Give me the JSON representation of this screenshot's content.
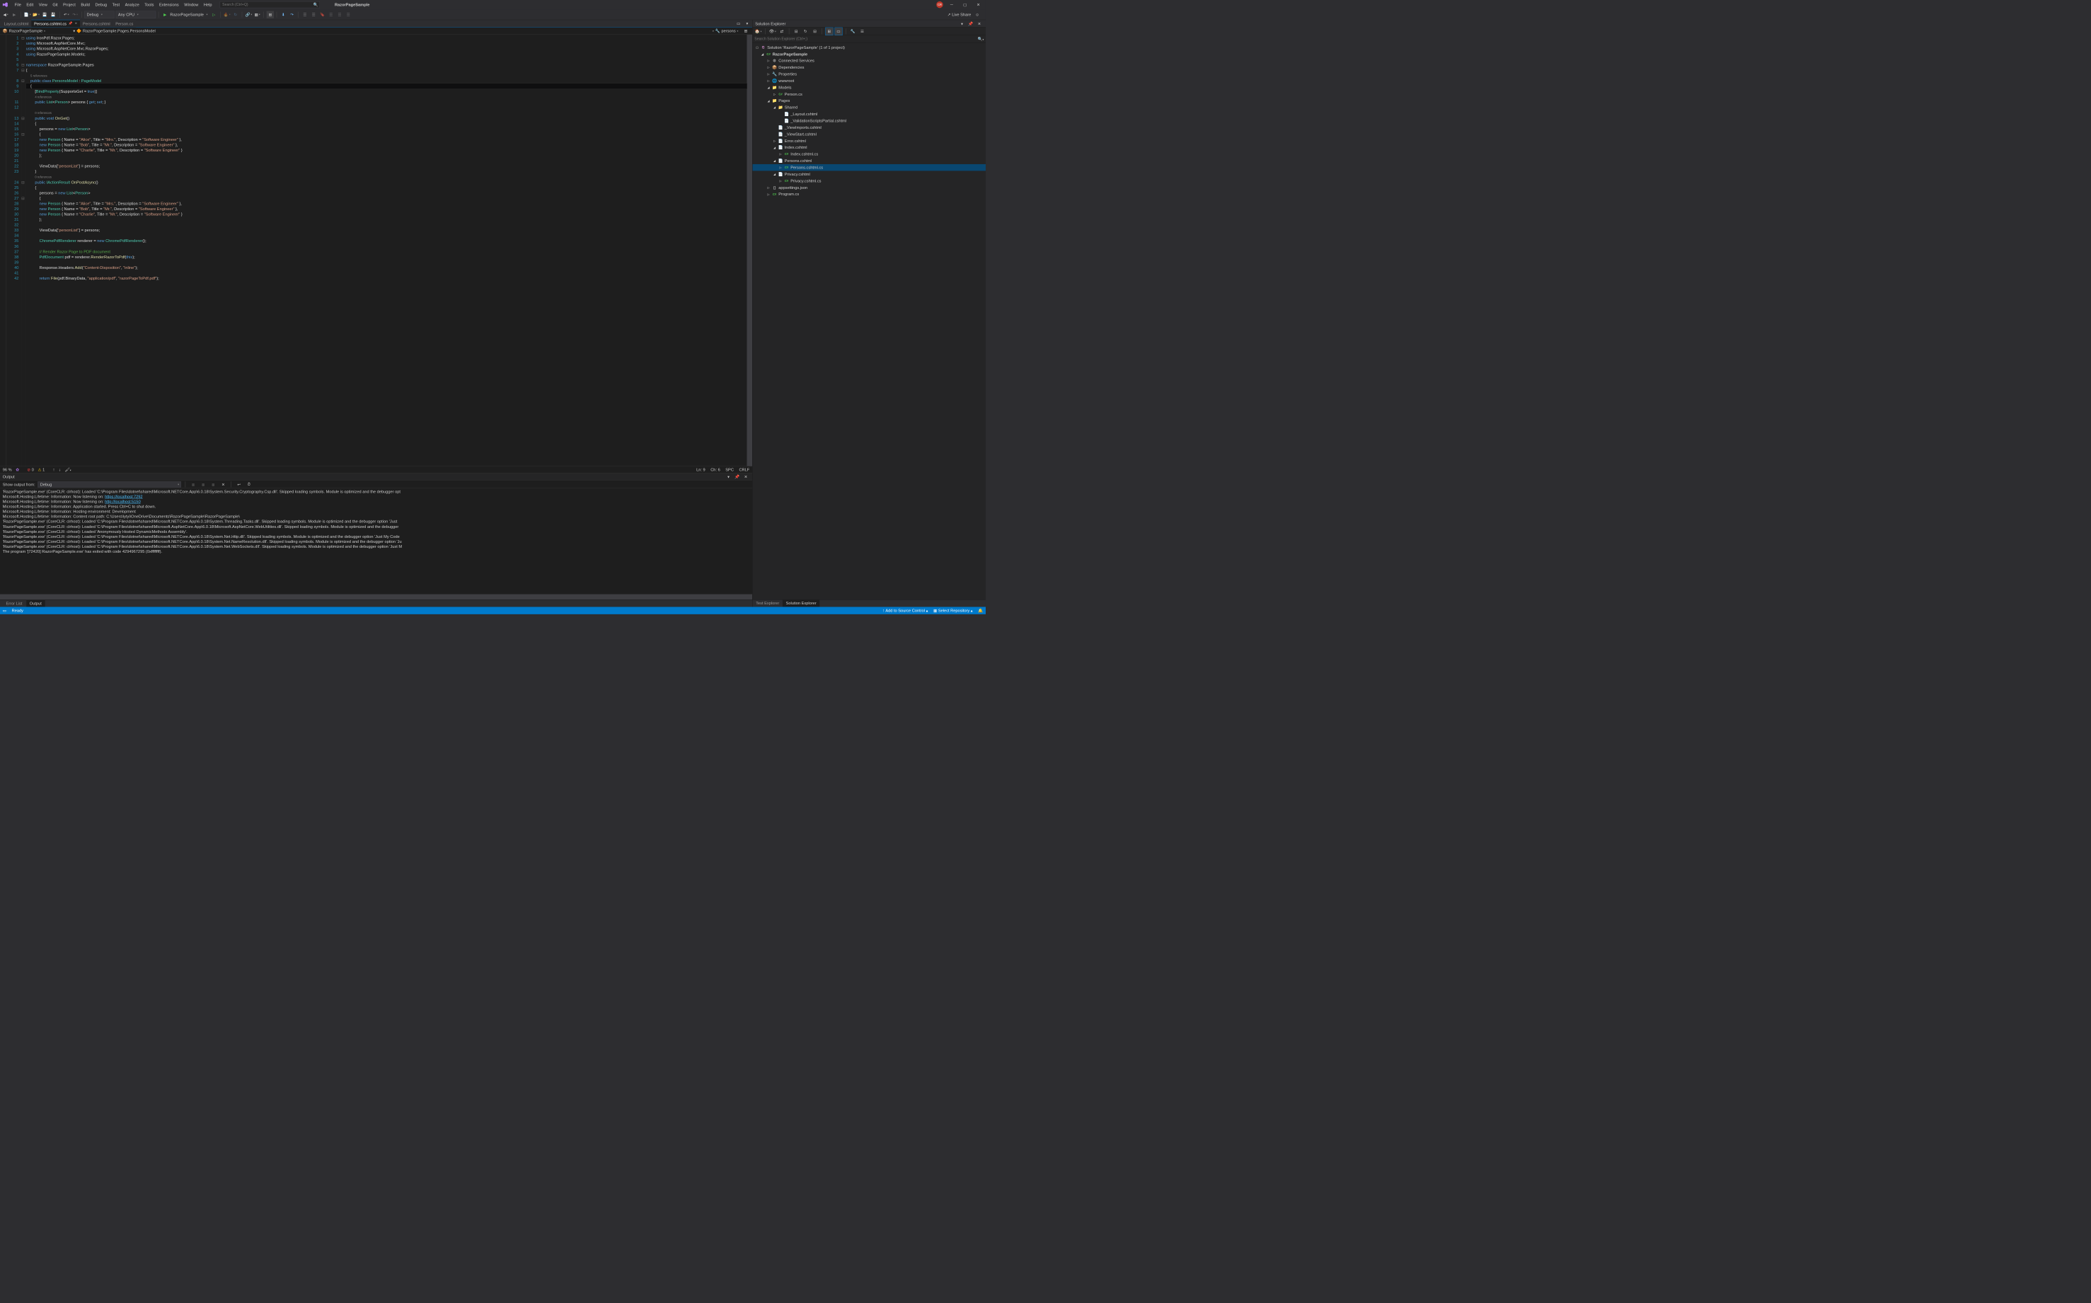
{
  "title": "RazorPageSample",
  "menu": [
    "File",
    "Edit",
    "View",
    "Git",
    "Project",
    "Build",
    "Debug",
    "Test",
    "Analyze",
    "Tools",
    "Extensions",
    "Window",
    "Help"
  ],
  "search_placeholder": "Search (Ctrl+Q)",
  "avatar_initials": "CR",
  "toolbar": {
    "config": "Debug",
    "platform": "Any CPU",
    "run_target": "RazorPageSample",
    "live_share": "Live Share"
  },
  "tabs": [
    {
      "label": "Layout.cshtml",
      "active": false
    },
    {
      "label": "Persons.cshtml.cs",
      "active": true
    },
    {
      "label": "Persons.cshtml",
      "active": false
    },
    {
      "label": "Person.cs",
      "active": false
    }
  ],
  "breadcrumb": {
    "project": "RazorPageSample",
    "namespace": "RazorPageSample.Pages.PersonsModel",
    "member": "persons"
  },
  "code_lines": [
    {
      "n": 1,
      "html": "<span class='kw'>using</span> IronPdf.Razor.Pages;"
    },
    {
      "n": 2,
      "html": "<span class='kw'>using</span> Microsoft.AspNetCore.Mvc;"
    },
    {
      "n": 3,
      "html": "<span class='kw'>using</span> Microsoft.AspNetCore.Mvc.RazorPages;"
    },
    {
      "n": 4,
      "html": "<span class='kw'>using</span> RazorPageSample.Models;"
    },
    {
      "n": 5,
      "html": ""
    },
    {
      "n": 6,
      "html": "<span class='kw'>namespace</span> RazorPageSample.Pages"
    },
    {
      "n": 7,
      "html": "{"
    },
    {
      "n": 0,
      "html": "    <span class='ref'>5 references</span>"
    },
    {
      "n": 8,
      "html": "    <span class='kw'>public</span> <span class='kw'>class</span> <span class='typ'>PersonsModel</span> : <span class='typ'>PageModel</span>"
    },
    {
      "n": 9,
      "html": "    {",
      "cl": true
    },
    {
      "n": 10,
      "html": "        [<span class='typ'>BindProperty</span>(SupportsGet = <span class='kw'>true</span>)]"
    },
    {
      "n": 0,
      "html": "        <span class='ref'>4 references</span>"
    },
    {
      "n": 11,
      "html": "        <span class='kw'>public</span> <span class='typ'>List</span>&lt;<span class='typ'>Person</span>&gt; persons { <span class='kw'>get</span>; <span class='kw'>set</span>; }"
    },
    {
      "n": 12,
      "html": ""
    },
    {
      "n": 0,
      "html": "        <span class='ref'>0 references</span>"
    },
    {
      "n": 13,
      "html": "        <span class='kw'>public</span> <span class='kw'>void</span> <span class='fn'>OnGet</span>()"
    },
    {
      "n": 14,
      "html": "        {"
    },
    {
      "n": 15,
      "html": "            persons = <span class='kw'>new</span> <span class='typ'>List</span>&lt;<span class='typ'>Person</span>&gt;"
    },
    {
      "n": 16,
      "html": "            {"
    },
    {
      "n": 17,
      "html": "            <span class='kw'>new</span> <span class='typ'>Person</span> { Name = <span class='str'>\"Alice\"</span>, Title = <span class='str'>\"Mrs.\"</span>, Description = <span class='str'>\"Software Engineer\"</span> },"
    },
    {
      "n": 18,
      "html": "            <span class='kw'>new</span> <span class='typ'>Person</span> { Name = <span class='str'>\"Bob\"</span>, Title = <span class='str'>\"Mr.\"</span>, Description = <span class='str'>\"Software Engineer\"</span> },"
    },
    {
      "n": 19,
      "html": "            <span class='kw'>new</span> <span class='typ'>Person</span> { Name = <span class='str'>\"Charlie\"</span>, Title = <span class='str'>\"Mr.\"</span>, Description = <span class='str'>\"Software Engineer\"</span> }"
    },
    {
      "n": 20,
      "html": "            };"
    },
    {
      "n": 21,
      "html": ""
    },
    {
      "n": 22,
      "html": "            ViewData[<span class='str'>\"personList\"</span>] = persons;"
    },
    {
      "n": 23,
      "html": "        }"
    },
    {
      "n": 0,
      "html": "        <span class='ref'>0 references</span>"
    },
    {
      "n": 24,
      "html": "        <span class='kw'>public</span> <span class='typ'>IActionResult</span> <span class='fn'>OnPostAsync</span>()"
    },
    {
      "n": 25,
      "html": "        {"
    },
    {
      "n": 26,
      "html": "            persons = <span class='kw'>new</span> <span class='typ'>List</span>&lt;<span class='typ'>Person</span>&gt;"
    },
    {
      "n": 27,
      "html": "            {"
    },
    {
      "n": 28,
      "html": "            <span class='kw'>new</span> <span class='typ'>Person</span> { Name = <span class='str'>\"Alice\"</span>, Title = <span class='str'>\"Mrs.\"</span>, Description = <span class='str'>\"Software Engineer\"</span> },"
    },
    {
      "n": 29,
      "html": "            <span class='kw'>new</span> <span class='typ'>Person</span> { Name = <span class='str'>\"Bob\"</span>, Title = <span class='str'>\"Mr.\"</span>, Description = <span class='str'>\"Software Engineer\"</span> },"
    },
    {
      "n": 30,
      "html": "            <span class='kw'>new</span> <span class='typ'>Person</span> { Name = <span class='str'>\"Charlie\"</span>, Title = <span class='str'>\"Mr.\"</span>, Description = <span class='str'>\"Software Engineer\"</span> }"
    },
    {
      "n": 31,
      "html": "            };"
    },
    {
      "n": 32,
      "html": ""
    },
    {
      "n": 33,
      "html": "            ViewData[<span class='str'>\"personList\"</span>] = persons;"
    },
    {
      "n": 34,
      "html": ""
    },
    {
      "n": 35,
      "html": "            <span class='typ'>ChromePdfRenderer</span> renderer = <span class='kw'>new</span> <span class='typ'>ChromePdfRenderer</span>();"
    },
    {
      "n": 36,
      "html": ""
    },
    {
      "n": 37,
      "html": "            <span class='com'>// Render Razor Page to PDF document</span>"
    },
    {
      "n": 38,
      "html": "            <span class='typ'>PdfDocument</span> pdf = renderer.<span class='fn'>RenderRazorToPdf</span>(<span class='kw'>this</span>);"
    },
    {
      "n": 39,
      "html": ""
    },
    {
      "n": 40,
      "html": "            Response.Headers.<span class='fn'>Add</span>(<span class='str'>\"Content-Disposition\"</span>, <span class='str'>\"inline\"</span>);"
    },
    {
      "n": 41,
      "html": ""
    },
    {
      "n": 42,
      "html": "            <span class='kw'>return</span> <span class='fn'>File</span>(pdf.BinaryData, <span class='str'>\"application/pdf\"</span>, <span class='str'>\"razorPageToPdf.pdf\"</span>);"
    }
  ],
  "editor_status": {
    "zoom": "96 %",
    "errors": "0",
    "warnings": "1",
    "ln": "Ln: 9",
    "ch": "Ch: 6",
    "spc": "SPC",
    "crlf": "CRLF"
  },
  "output": {
    "title": "Output",
    "from_label": "Show output from:",
    "from_value": "Debug",
    "lines": [
      "'RazorPageSample.exe' (CoreCLR: clrhost): Loaded 'C:\\Program Files\\dotnet\\shared\\Microsoft.NETCore.App\\6.0.18\\System.Security.Cryptography.Csp.dll'. Skipped loading symbols. Module is optimized and the debugger opt",
      "Microsoft.Hosting.Lifetime: Information: Now listening on: <span class='link'>https://localhost:7292</span>",
      "Microsoft.Hosting.Lifetime: Information: Now listening on: <span class='link'>http://localhost:5150</span>",
      "Microsoft.Hosting.Lifetime: Information: Application started. Press Ctrl+C to shut down.",
      "Microsoft.Hosting.Lifetime: Information: Hosting environment: Development",
      "Microsoft.Hosting.Lifetime: Information: Content root path: C:\\Users\\lytyi\\OneDrive\\Documents\\RazorPageSample\\RazorPageSample\\",
      "'RazorPageSample.exe' (CoreCLR: clrhost): Loaded 'C:\\Program Files\\dotnet\\shared\\Microsoft.NETCore.App\\6.0.18\\System.Threading.Tasks.dll'. Skipped loading symbols. Module is optimized and the debugger option 'Just",
      "'RazorPageSample.exe' (CoreCLR: clrhost): Loaded 'C:\\Program Files\\dotnet\\shared\\Microsoft.AspNetCore.App\\6.0.18\\Microsoft.AspNetCore.WebUtilities.dll'. Skipped loading symbols. Module is optimized and the debugger",
      "'RazorPageSample.exe' (CoreCLR: clrhost): Loaded 'Anonymously Hosted DynamicMethods Assembly'.",
      "'RazorPageSample.exe' (CoreCLR: clrhost): Loaded 'C:\\Program Files\\dotnet\\shared\\Microsoft.NETCore.App\\6.0.18\\System.Net.Http.dll'. Skipped loading symbols. Module is optimized and the debugger option 'Just My Code",
      "'RazorPageSample.exe' (CoreCLR: clrhost): Loaded 'C:\\Program Files\\dotnet\\shared\\Microsoft.NETCore.App\\6.0.18\\System.Net.NameResolution.dll'. Skipped loading symbols. Module is optimized and the debugger option 'Ju",
      "'RazorPageSample.exe' (CoreCLR: clrhost): Loaded 'C:\\Program Files\\dotnet\\shared\\Microsoft.NETCore.App\\6.0.18\\System.Net.WebSockets.dll'. Skipped loading symbols. Module is optimized and the debugger option 'Just M",
      "The program '[72420] RazorPageSample.exe' has exited with code 4294967295 (0xffffffff).",
      ""
    ]
  },
  "bottom_tabs": [
    {
      "label": "Error List",
      "active": false
    },
    {
      "label": "Output",
      "active": true
    }
  ],
  "solution": {
    "title": "Solution Explorer",
    "search_placeholder": "Search Solution Explorer (Ctrl+;)",
    "root": "Solution 'RazorPageSample' (1 of 1 project)",
    "tree": [
      {
        "ind": 1,
        "exp": "▢",
        "icon": "cs",
        "label": "RazorPageSample",
        "bold": true
      },
      {
        "ind": 2,
        "exp": "▷",
        "icon": "⚙",
        "label": "Connected Services"
      },
      {
        "ind": 2,
        "exp": "▷",
        "icon": "📦",
        "label": "Dependencies"
      },
      {
        "ind": 2,
        "exp": "▷",
        "icon": "🔧",
        "label": "Properties"
      },
      {
        "ind": 2,
        "exp": "▷",
        "icon": "🌐",
        "label": "wwwroot"
      },
      {
        "ind": 2,
        "exp": "▢",
        "icon": "📁",
        "label": "Models"
      },
      {
        "ind": 3,
        "exp": "▷",
        "icon": "C#",
        "label": "Person.cs"
      },
      {
        "ind": 2,
        "exp": "▢",
        "icon": "📁",
        "label": "Pages"
      },
      {
        "ind": 3,
        "exp": "▢",
        "icon": "📁",
        "label": "Shared"
      },
      {
        "ind": 4,
        "exp": "",
        "icon": "📄",
        "label": "_Layout.cshtml"
      },
      {
        "ind": 4,
        "exp": "",
        "icon": "📄",
        "label": "_ValidationScriptsPartial.cshtml"
      },
      {
        "ind": 3,
        "exp": "",
        "icon": "📄",
        "label": "_ViewImports.cshtml"
      },
      {
        "ind": 3,
        "exp": "",
        "icon": "📄",
        "label": "_ViewStart.cshtml"
      },
      {
        "ind": 3,
        "exp": "▷",
        "icon": "📄",
        "label": "Error.cshtml"
      },
      {
        "ind": 3,
        "exp": "▢",
        "icon": "📄",
        "label": "Index.cshtml"
      },
      {
        "ind": 4,
        "exp": "▷",
        "icon": "C#",
        "label": "Index.cshtml.cs"
      },
      {
        "ind": 3,
        "exp": "▢",
        "icon": "📄",
        "label": "Persons.cshtml"
      },
      {
        "ind": 4,
        "exp": "▷",
        "icon": "C#",
        "label": "Persons.cshtml.cs",
        "selected": true
      },
      {
        "ind": 3,
        "exp": "▢",
        "icon": "📄",
        "label": "Privacy.cshtml"
      },
      {
        "ind": 4,
        "exp": "▷",
        "icon": "C#",
        "label": "Privacy.cshtml.cs"
      },
      {
        "ind": 2,
        "exp": "▷",
        "icon": "{}",
        "label": "appsettings.json"
      },
      {
        "ind": 2,
        "exp": "▷",
        "icon": "C#",
        "label": "Program.cs"
      }
    ],
    "bottom_tabs": [
      {
        "label": "Test Explorer",
        "active": false
      },
      {
        "label": "Solution Explorer",
        "active": true
      }
    ]
  },
  "statusbar": {
    "ready": "Ready",
    "add_source": "Add to Source Control",
    "select_repo": "Select Repository"
  }
}
